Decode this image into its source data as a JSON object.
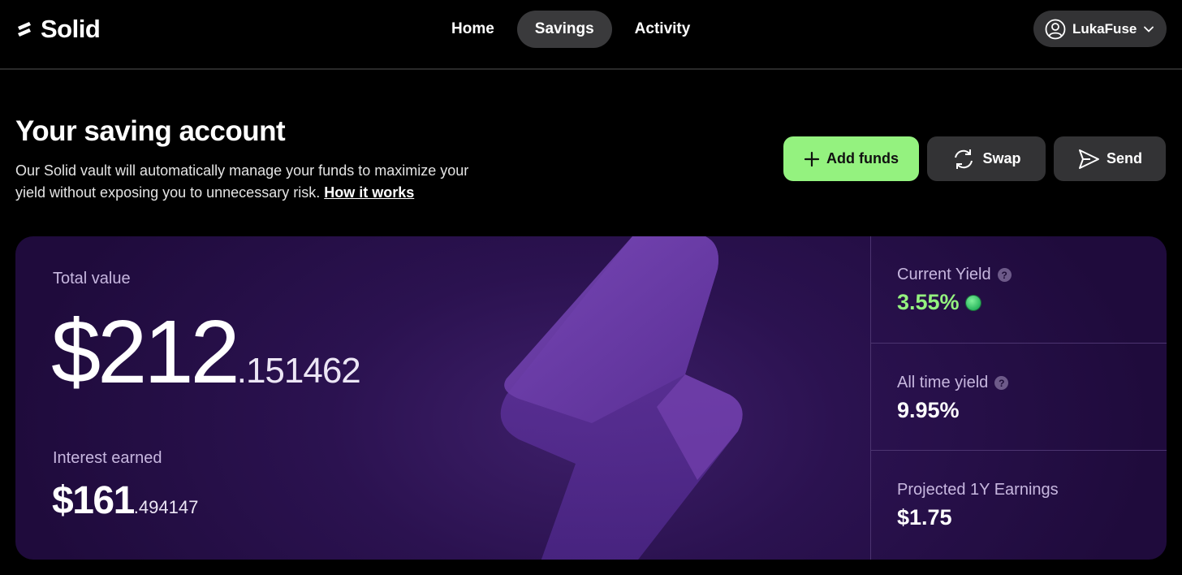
{
  "app": {
    "name": "Solid"
  },
  "nav": {
    "items": [
      "Home",
      "Savings",
      "Activity"
    ],
    "active": "Savings"
  },
  "user": {
    "name": "LukaFuse"
  },
  "page": {
    "title": "Your saving account",
    "description": "Our Solid vault will automatically manage your funds to maximize your yield without exposing you to unnecessary risk.",
    "link": "How it works"
  },
  "actions": {
    "add_funds": "Add funds",
    "swap": "Swap",
    "send": "Send"
  },
  "card": {
    "total_label": "Total value",
    "total_int": "$212",
    "total_dec": ".151462",
    "interest_label": "Interest earned",
    "interest_int": "$161",
    "interest_dec": ".494147",
    "current_yield_label": "Current Yield",
    "current_yield_value": "3.55%",
    "all_time_label": "All time yield",
    "all_time_value": "9.95%",
    "projected_label": "Projected 1Y Earnings",
    "projected_value": "$1.75"
  },
  "colors": {
    "accent_green": "#94f27f",
    "card_purple": "#2b1250",
    "button_dark": "#333335"
  }
}
